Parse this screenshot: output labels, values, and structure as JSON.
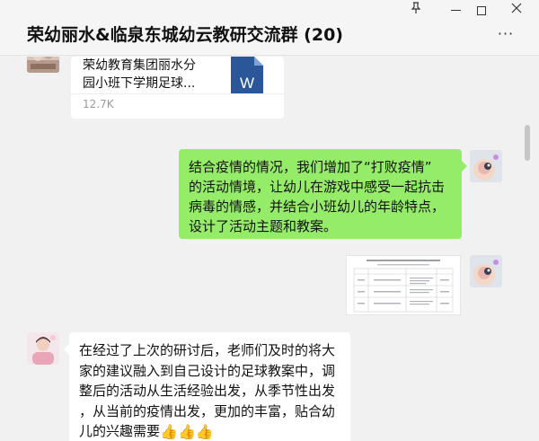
{
  "window": {
    "title": "荣幼丽水&临泉东城幼云教研交流群 (20)",
    "controls": {
      "pin": "⚲",
      "minimize": "minimize",
      "maximize": "maximize",
      "close": "✕"
    },
    "more": "···"
  },
  "messages": {
    "file": {
      "name_line1": "荣幼教育集团丽水分",
      "name_line2": "园小班下学期足球...",
      "icon_letter": "W",
      "size": "12.7K"
    },
    "green_text": [
      "结合疫情的情况，我们增加了“打败疫情”",
      "的活动情境，让幼儿在游戏中感受一起抗击",
      "病毒的情感，并结合小班幼儿的年龄特点，",
      "设计了活动主题和教案。"
    ],
    "white_text": [
      "在经过了上次的研讨后，老师们及时的将大",
      "家的建议融入到自己设计的足球教案中，调",
      "整后的活动从生活经验出发，从季节性出发",
      "，从当前的疫情出发，更加的丰富，贴合幼",
      "儿的兴趣需要"
    ],
    "thumbs": "👍👍👍"
  },
  "colors": {
    "green_bubble": "#95ec69",
    "word_icon": "#2b579a",
    "background": "#f1f1f1"
  }
}
